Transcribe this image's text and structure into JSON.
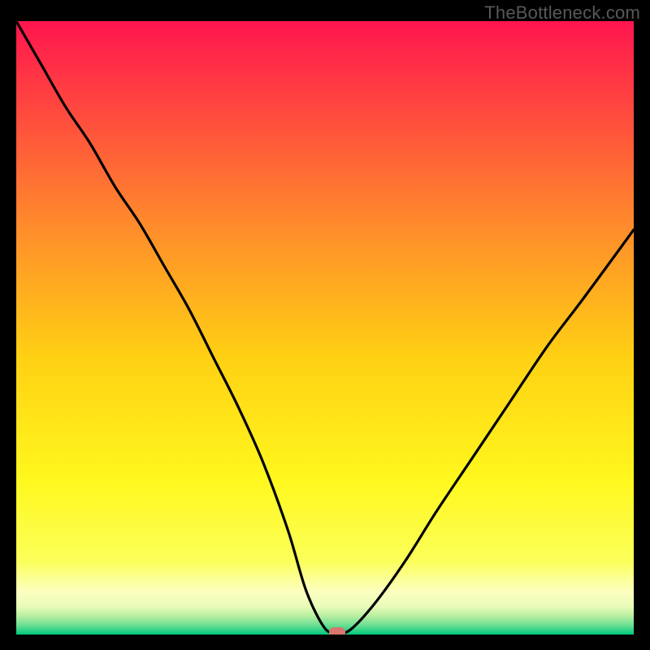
{
  "watermark": "TheBottleneck.com",
  "colors": {
    "bg_top": "#ff154e",
    "bg_q1": "#ff7d31",
    "bg_mid": "#ffd813",
    "bg_q3": "#fffb3b",
    "bg_low": "#fdffb6",
    "bg_band1": "#d8f7a6",
    "bg_band2": "#9de8a0",
    "bg_band3": "#54d992",
    "bg_bottom": "#00c87b",
    "curve": "#000000",
    "marker": "#d9766e",
    "frame": "#000000",
    "watermark_color": "#585858"
  },
  "chart_data": {
    "type": "line",
    "title": "",
    "xlabel": "",
    "ylabel": "",
    "xlim": [
      0,
      100
    ],
    "ylim": [
      0,
      100
    ],
    "grid": false,
    "legend": false,
    "series": [
      {
        "name": "bottleneck-curve",
        "x": [
          0,
          4,
          8,
          12,
          16,
          20,
          24,
          28,
          32,
          36,
          40,
          44,
          47,
          50,
          52,
          54,
          58,
          63,
          68,
          74,
          80,
          86,
          92,
          100
        ],
        "y": [
          100,
          93,
          86,
          80,
          73,
          67,
          60,
          53,
          45,
          37,
          28,
          17,
          7,
          1,
          0.5,
          0.7,
          5,
          12,
          20,
          29,
          38,
          47,
          55,
          66
        ]
      }
    ],
    "marker": {
      "x": 52,
      "y": 0.3
    },
    "annotations": []
  }
}
